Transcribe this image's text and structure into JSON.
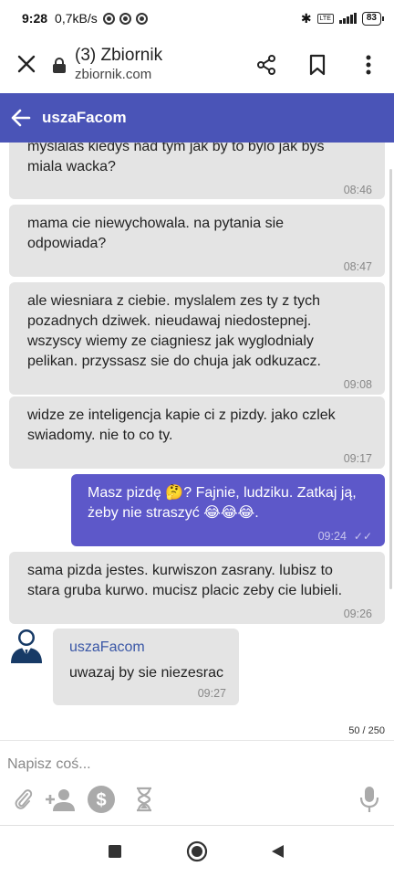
{
  "status_bar": {
    "time": "9:28",
    "network_speed": "0,7kB/s",
    "battery": "83",
    "volte": "LTE"
  },
  "browser": {
    "tab_title": "(3) Zbiornik",
    "domain": "zbiornik.com"
  },
  "chat_header": {
    "contact_name": "uszaFacom"
  },
  "messages": [
    {
      "text": "myslalas kiedys nad tym jak by to bylo jak bys\nmiala wacka?",
      "time": "08:46",
      "outgoing": false
    },
    {
      "text": "mama cie niewychowala. na pytania sie\nodpowiada?",
      "time": "08:47",
      "outgoing": false
    },
    {
      "text": "ale wiesniara z ciebie. myslalem zes ty z tych\npozadnych dziwek. nieudawaj niedostepnej.\nwszyscy wiemy ze ciagniesz jak wyglodnialy\npelikan. przyssasz sie do chuja jak odkuzacz.",
      "time": "09:08",
      "outgoing": false
    },
    {
      "text": "widze ze inteligencja kapie ci z pizdy. jako czlek\nswiadomy. nie to co ty.",
      "time": "09:17",
      "outgoing": false
    },
    {
      "text": "Masz pizdę 🤔? Fajnie, ludziku. Zatkaj ją,\nżeby nie straszyć 😂😂😂.",
      "time": "09:24",
      "outgoing": true,
      "status": "read"
    },
    {
      "text": "sama pizda jestes. kurwiszon zasrany. lubisz to\nstara gruba kurwo. mucisz placic zeby cie lubieli.",
      "time": "09:26",
      "outgoing": false
    },
    {
      "sender": "uszaFacom",
      "text": "uwazaj by sie niezesrac",
      "time": "09:27",
      "outgoing": false
    }
  ],
  "composer": {
    "placeholder": "Napisz coś...",
    "char_counter": "50 / 250"
  },
  "icons": {
    "attach": "paperclip-icon",
    "add_person": "add-person-icon",
    "money": "dollar-icon",
    "timer": "hourglass-icon",
    "mic": "microphone-icon"
  },
  "colors": {
    "header": "#4a54b7",
    "outgoing_bubble": "#5d58c9",
    "incoming_bubble": "#e4e4e4",
    "sender_name": "#3a57a6"
  }
}
